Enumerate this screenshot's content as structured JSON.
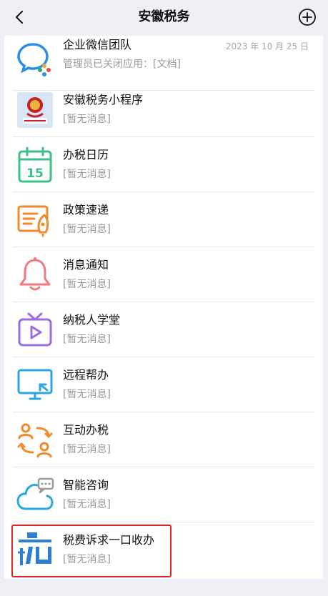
{
  "header": {
    "title": "安徽税务",
    "back_icon": "chevron-left-icon",
    "add_icon": "plus-circle-icon"
  },
  "items": [
    {
      "name": "企业微信团队",
      "sub": "管理员已关闭应用：[文档]",
      "date": "2023 年 10 月 25 日",
      "icon": "wecom-chat-icon"
    },
    {
      "name": "安徽税务小程序",
      "sub": "[暂无消息]",
      "icon": "tax-emblem-icon"
    },
    {
      "name": "办税日历",
      "sub": "[暂无消息]",
      "icon": "calendar-icon",
      "icon_text": "15"
    },
    {
      "name": "政策速递",
      "sub": "[暂无消息]",
      "icon": "document-rocket-icon"
    },
    {
      "name": "消息通知",
      "sub": "[暂无消息]",
      "icon": "bell-icon"
    },
    {
      "name": "纳税人学堂",
      "sub": "[暂无消息]",
      "icon": "tv-play-icon"
    },
    {
      "name": "远程帮办",
      "sub": "[暂无消息]",
      "icon": "monitor-cursor-icon"
    },
    {
      "name": "互动办税",
      "sub": "[暂无消息]",
      "icon": "users-exchange-icon"
    },
    {
      "name": "智能咨询",
      "sub": "[暂无消息]",
      "icon": "cloud-chat-icon"
    },
    {
      "name": "税费诉求一口收办",
      "sub": "[暂无消息]",
      "icon": "shui-logo-icon"
    }
  ],
  "colors": {
    "highlight": "#e0242b",
    "background": "#eef0f6"
  }
}
